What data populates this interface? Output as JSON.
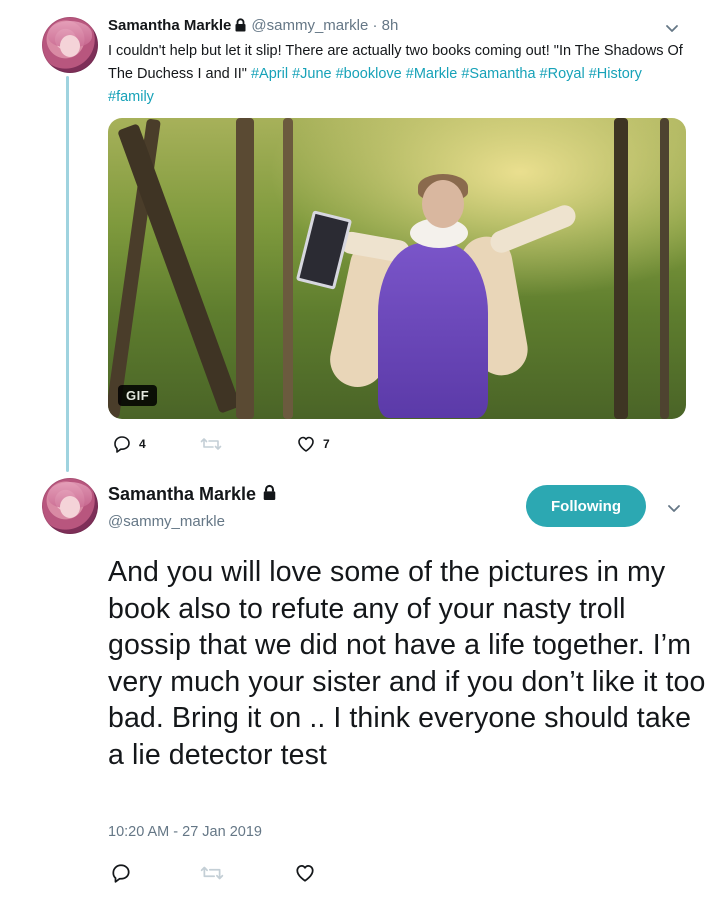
{
  "tweet1": {
    "author_name": "Samantha Markle",
    "handle": "@sammy_markle",
    "time_ago": "8h",
    "text": "I couldn't help but let it slip! There are actually two books coming out! \"In The Shadows Of The Duchess I and II\"",
    "hashtags": "#April #June #booklove #Markle #Samantha #Royal #History #family",
    "media_badge": "GIF",
    "reply_count": "4",
    "retweet_count": "",
    "like_count": "7"
  },
  "tweet2": {
    "author_name": "Samantha Markle",
    "handle": "@sammy_markle",
    "follow_label": "Following",
    "text": "And you will love some of the pictures in my book also to refute any of your nasty troll gossip that we did not have a life together. I’m very much your sister and if you don’t like it too bad. Bring it on .. I think everyone should take a lie detector test",
    "timestamp": "10:20 AM - 27 Jan 2019"
  },
  "colors": {
    "accent": "#2ca8b2",
    "thread_line": "#9fd3df",
    "secondary_text": "#657786"
  },
  "icons": [
    "lock-icon",
    "chevron-down-icon",
    "reply-icon",
    "retweet-icon",
    "like-icon"
  ]
}
